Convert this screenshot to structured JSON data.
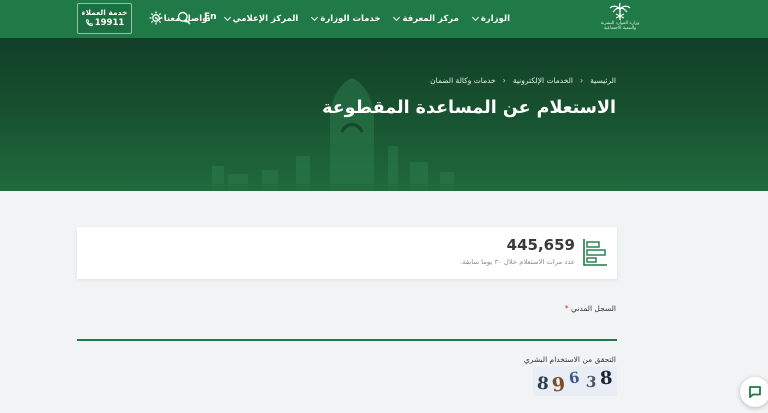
{
  "header": {
    "logo_text": [
      "وزارة الموارد البشرية",
      "والتنمية الاجتماعية"
    ],
    "nav": [
      {
        "label": "الوزارة"
      },
      {
        "label": "مركز المعرفة"
      },
      {
        "label": "خدمات الوزارة"
      },
      {
        "label": "المركز الإعلامي"
      },
      {
        "label": "تواصل معنا"
      }
    ],
    "lang_label": "En",
    "icons": [
      "search-icon",
      "accessibility-icon",
      "phone-icon"
    ],
    "customer_care": {
      "label": "خدمة العملاء",
      "number": "19911"
    },
    "accent": "#1f7a47"
  },
  "hero": {
    "breadcrumb": [
      "الرئيسية",
      "الخدمات الإلكترونية",
      "خدمات وكالة الضمان"
    ],
    "title": "الاستعلام عن المساعدة المقطوعة"
  },
  "stat": {
    "value": "445,659",
    "label": "عدد مرات الاستعلام خلال ٣٠ يوما سابقة."
  },
  "form": {
    "civil_label": "السجل المدني",
    "civil_required": "*",
    "civil_value": "",
    "captcha_label": "التحقق من الاستخدام البشري",
    "captcha_chars": [
      "8",
      "9",
      "6",
      "3",
      "8"
    ]
  }
}
